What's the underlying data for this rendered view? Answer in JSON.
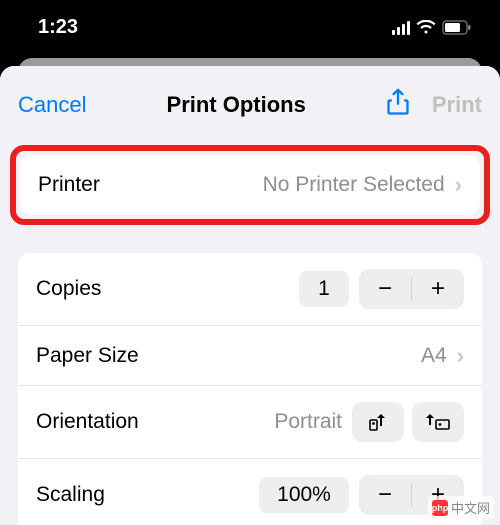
{
  "status": {
    "time": "1:23"
  },
  "nav": {
    "cancel": "Cancel",
    "title": "Print Options",
    "print": "Print"
  },
  "printer": {
    "label": "Printer",
    "value": "No Printer Selected"
  },
  "settings": {
    "copies": {
      "label": "Copies",
      "value": "1"
    },
    "paper": {
      "label": "Paper Size",
      "value": "A4"
    },
    "orient": {
      "label": "Orientation",
      "value": "Portrait"
    },
    "scaling": {
      "label": "Scaling",
      "value": "100%"
    }
  },
  "watermark": "中文网"
}
